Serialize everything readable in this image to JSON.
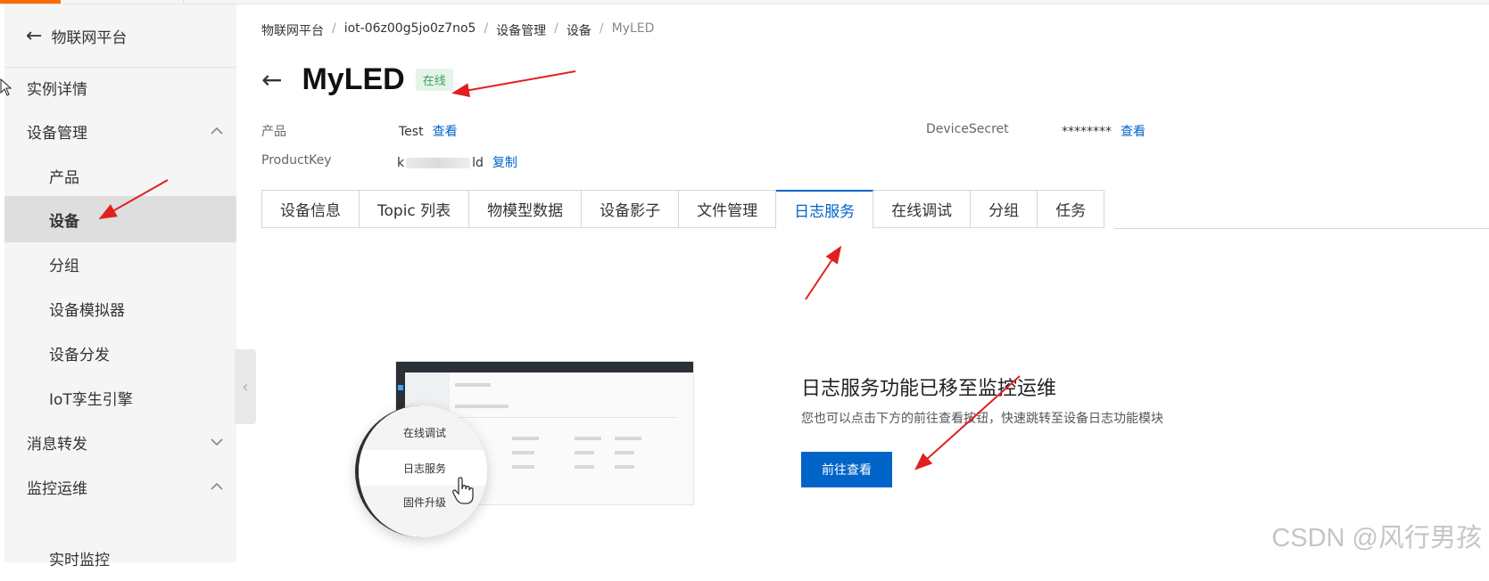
{
  "sidebar": {
    "title": "物联网平台",
    "items": [
      {
        "label": "实例详情"
      },
      {
        "label": "设备管理"
      },
      {
        "label": "产品"
      },
      {
        "label": "设备"
      },
      {
        "label": "分组"
      },
      {
        "label": "设备模拟器"
      },
      {
        "label": "设备分发"
      },
      {
        "label": "IoT孪生引擎"
      },
      {
        "label": "消息转发"
      },
      {
        "label": "监控运维"
      },
      {
        "label": "实时监控"
      }
    ]
  },
  "breadcrumb": [
    "物联网平台",
    "iot-06z00g5jo0z7no5",
    "设备管理",
    "设备",
    "MyLED"
  ],
  "device": {
    "name": "MyLED",
    "status": "在线",
    "product_label": "产品",
    "product_value": "Test",
    "product_link": "查看",
    "productkey_label": "ProductKey",
    "productkey_prefix": "k",
    "productkey_suffix": "ld",
    "productkey_link": "复制",
    "secret_label": "DeviceSecret",
    "secret_value": "********",
    "secret_link": "查看"
  },
  "tabs": [
    "设备信息",
    "Topic 列表",
    "物模型数据",
    "设备影子",
    "文件管理",
    "日志服务",
    "在线调试",
    "分组",
    "任务"
  ],
  "active_tab": "日志服务",
  "illustration": {
    "menu": [
      "在线调试",
      "日志服务",
      "固件升级"
    ]
  },
  "notice": {
    "title": "日志服务功能已移至监控运维",
    "desc": "您也可以点击下方的前往查看按钮，快速跳转至设备日志功能模块",
    "button": "前往查看"
  },
  "watermark": "CSDN @风行男孩",
  "colors": {
    "accent": "#0064c8",
    "online_bg": "#e5f4e8",
    "online_text": "#3aa35e",
    "annotation": "#e02020",
    "brand": "#ff6a00"
  }
}
